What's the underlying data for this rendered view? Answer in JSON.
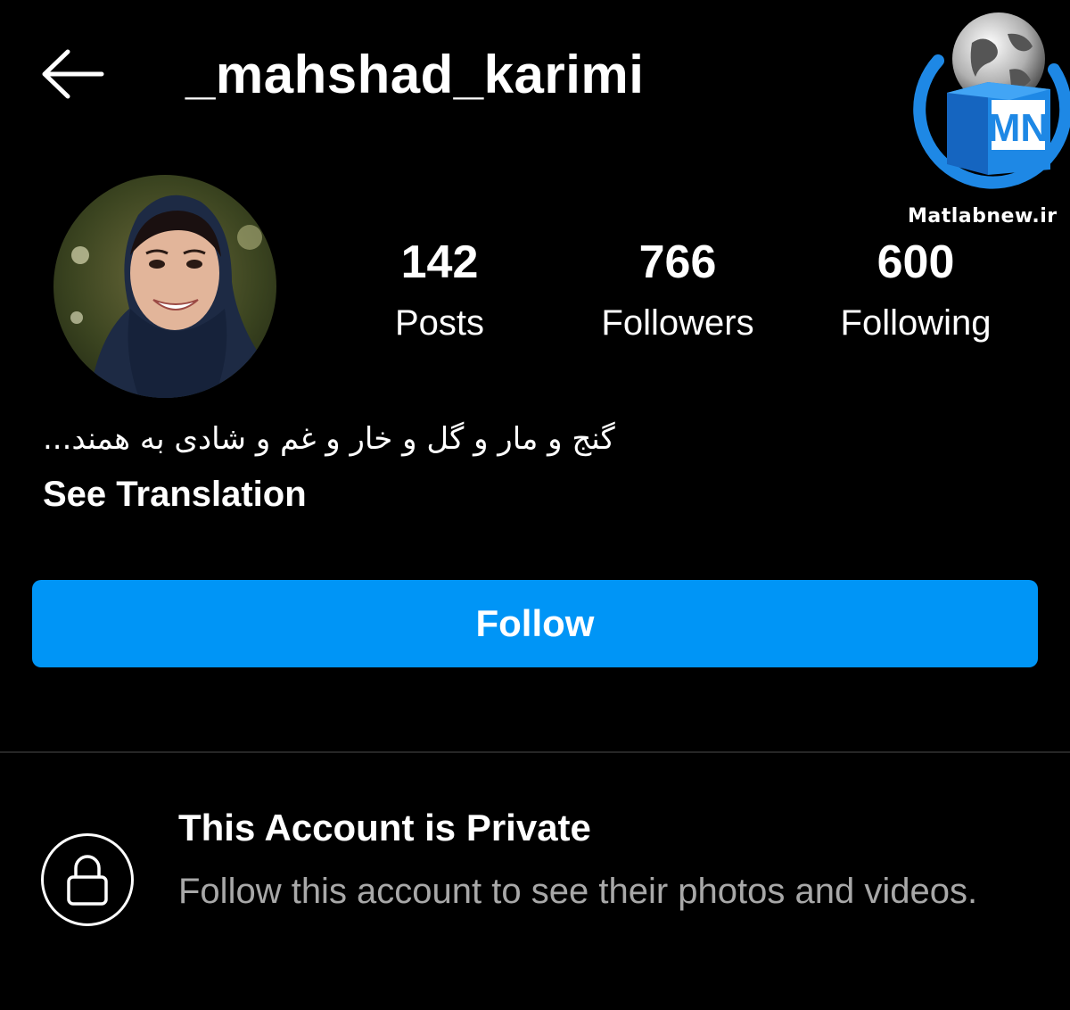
{
  "header": {
    "back_icon": "arrow-left-icon",
    "username": "_mahshad_karimi"
  },
  "watermark": {
    "logo_letters": "MN",
    "site": "Matlabnew.ir",
    "brand_color": "#1e88e5"
  },
  "profile": {
    "avatar_icon": "profile-photo",
    "stats": [
      {
        "value": "142",
        "label": "Posts"
      },
      {
        "value": "766",
        "label": "Followers"
      },
      {
        "value": "600",
        "label": "Following"
      }
    ],
    "bio": "گنج و مار و گل و خار و غم و شادی به همند...",
    "see_translation": "See Translation"
  },
  "actions": {
    "follow_label": "Follow",
    "follow_color": "#0095f6"
  },
  "private_notice": {
    "icon": "lock-icon",
    "title": "This Account is Private",
    "subtitle": "Follow this account to see their photos and videos."
  }
}
